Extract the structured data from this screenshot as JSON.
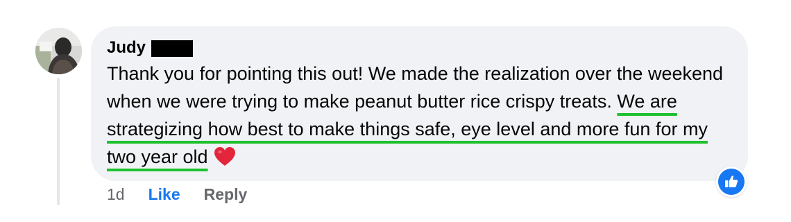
{
  "comment": {
    "author": "Judy",
    "text_plain_1": "Thank you for pointing this out! We made the realization over the weekend when we were trying to make peanut butter rice crispy treats. ",
    "text_highlight": "We are strategizing how best to make things safe, eye level and more fun for my two year old",
    "emoji_icon": "red-heart-icon"
  },
  "actions": {
    "timestamp": "1d",
    "like_label": "Like",
    "reply_label": "Reply"
  },
  "reaction": {
    "type": "like",
    "icon": "thumbs-up-icon"
  },
  "colors": {
    "bubble": "#f0f2f5",
    "underline": "#1fc12f",
    "like_blue": "#1877f2",
    "muted_text": "#65676b",
    "heart": "#e3253b"
  }
}
